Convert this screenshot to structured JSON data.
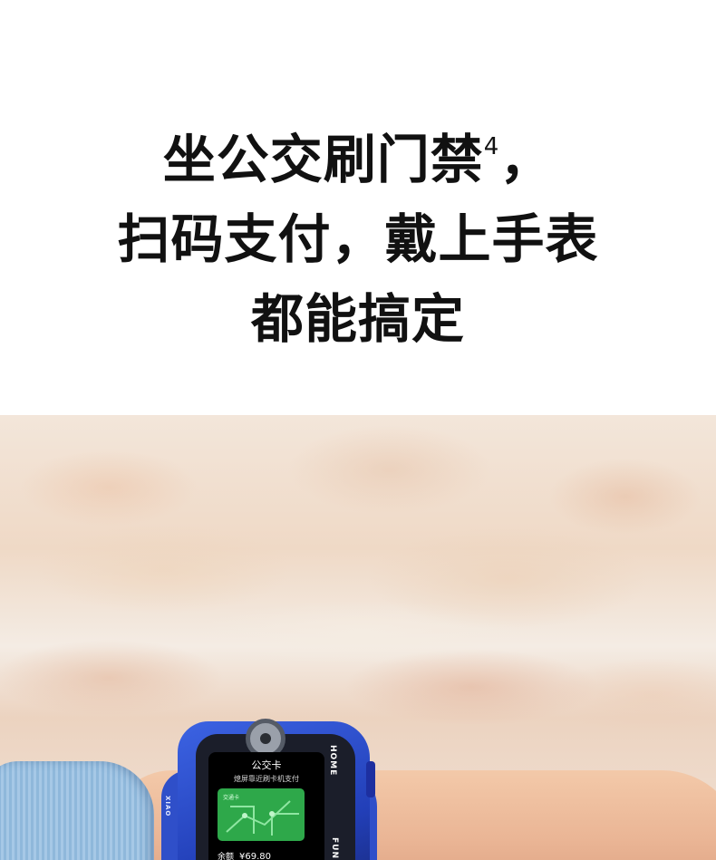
{
  "headline": {
    "line1": "坐公交刷门禁",
    "footnote": "4",
    "line1_end": "，",
    "line2": "扫码支付，戴上手表",
    "line3": "都能搞定"
  },
  "watch": {
    "side_home_label": "HOME",
    "side_fun_label": "FUN",
    "side_left_label": "XIAO",
    "screen": {
      "title": "公交卡",
      "hint": "熄屏靠近刷卡机支付",
      "card_label": "交通卡",
      "balance_label": "余额",
      "balance_value": "¥69.80"
    }
  },
  "colors": {
    "watch_body": "#2f4fc9",
    "card_green": "#2ea84a",
    "text": "#111111"
  }
}
